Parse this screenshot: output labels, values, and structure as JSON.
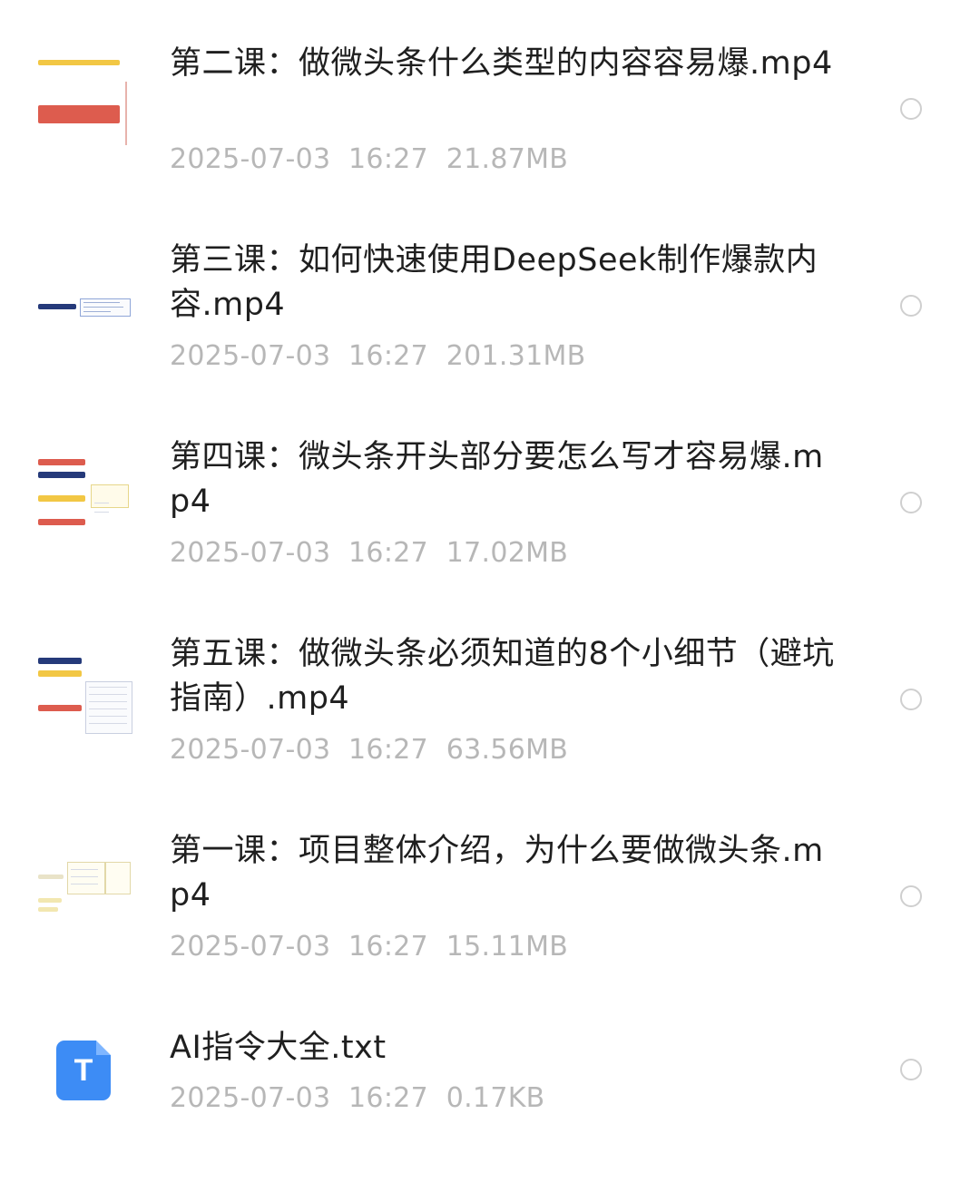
{
  "files": [
    {
      "name": "第二课：做微头条什么类型的内容容易爆.mp4",
      "date": "2025-07-03",
      "time": "16:27",
      "size": "21.87MB",
      "thumbnail": "mindmap-thumbnail"
    },
    {
      "name": "第三课：如何快速使用DeepSeek制作爆款内容.mp4",
      "date": "2025-07-03",
      "time": "16:27",
      "size": "201.31MB",
      "thumbnail": "mindmap-thumbnail"
    },
    {
      "name": "第四课：微头条开头部分要怎么写才容易爆.mp4",
      "date": "2025-07-03",
      "time": "16:27",
      "size": "17.02MB",
      "thumbnail": "mindmap-thumbnail"
    },
    {
      "name": "第五课：做微头条必须知道的8个小细节（避坑指南）.mp4",
      "date": "2025-07-03",
      "time": "16:27",
      "size": "63.56MB",
      "thumbnail": "mindmap-thumbnail"
    },
    {
      "name": "第一课：项目整体介绍，为什么要做微头条.mp4",
      "date": "2025-07-03",
      "time": "16:27",
      "size": "15.11MB",
      "thumbnail": "mindmap-thumbnail"
    },
    {
      "name": "AI指令大全.txt",
      "date": "2025-07-03",
      "time": "16:27",
      "size": "0.17KB",
      "thumbnail": "text-file-icon",
      "icon_letter": "T"
    }
  ],
  "colors": {
    "text_primary": "#1f1f1f",
    "text_secondary": "#b7b7b7",
    "radio_border": "#cfcfcf",
    "txt_icon": "#3d8cf5",
    "thumb_red": "#dd5c4e",
    "thumb_yellow": "#f2c744",
    "thumb_navy": "#253a7a"
  }
}
